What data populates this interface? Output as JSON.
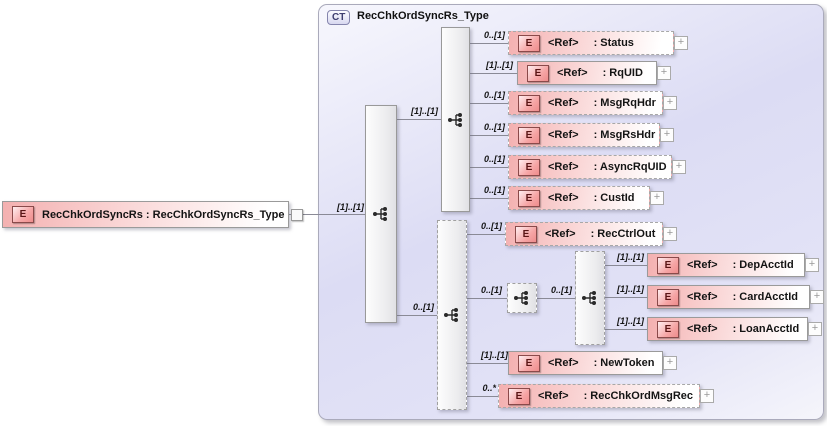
{
  "complex_type": {
    "badge": "CT",
    "title": "RecChkOrdSyncRs_Type"
  },
  "root_element": {
    "icon": "E",
    "label": "RecChkOrdSyncRs : RecChkOrdSyncRs_Type",
    "cardinality": "[1]..[1]"
  },
  "icons": {
    "element_letter": "E",
    "expand": "+",
    "sequence": "sequence-compositor"
  },
  "compositors": {
    "main": {
      "cardinality_in": "[1]..[1]",
      "cardinality_to_top": "[1]..[1]",
      "cardinality_to_bottom": "0..[1]"
    },
    "inner": {
      "cardinality_in": "0..[1]",
      "cardinality_out": "0..[1]"
    }
  },
  "nodes": {
    "status": {
      "icon": "E",
      "ref": "<Ref>",
      "name": ": Status",
      "cardinality": "0..[1]"
    },
    "rquid": {
      "icon": "E",
      "ref": "<Ref>",
      "name": ": RqUID",
      "cardinality": "[1]..[1]"
    },
    "msgrqhdr": {
      "icon": "E",
      "ref": "<Ref>",
      "name": ": MsgRqHdr",
      "cardinality": "0..[1]"
    },
    "msgrshdr": {
      "icon": "E",
      "ref": "<Ref>",
      "name": ": MsgRsHdr",
      "cardinality": "0..[1]"
    },
    "asyncrquid": {
      "icon": "E",
      "ref": "<Ref>",
      "name": ": AsyncRqUID",
      "cardinality": "0..[1]"
    },
    "custid": {
      "icon": "E",
      "ref": "<Ref>",
      "name": ": CustId",
      "cardinality": "0..[1]"
    },
    "recctrlout": {
      "icon": "E",
      "ref": "<Ref>",
      "name": ": RecCtrlOut",
      "cardinality": "0..[1]"
    },
    "depacctid": {
      "icon": "E",
      "ref": "<Ref>",
      "name": ": DepAcctId",
      "cardinality": "[1]..[1]"
    },
    "cardacctid": {
      "icon": "E",
      "ref": "<Ref>",
      "name": ": CardAcctId",
      "cardinality": "[1]..[1]"
    },
    "loanacctid": {
      "icon": "E",
      "ref": "<Ref>",
      "name": ": LoanAcctId",
      "cardinality": "[1]..[1]"
    },
    "newtoken": {
      "icon": "E",
      "ref": "<Ref>",
      "name": ": NewToken",
      "cardinality": "[1]..[1]"
    },
    "recchkordmsgrec": {
      "icon": "E",
      "ref": "<Ref>",
      "name": ": RecChkOrdMsgRec",
      "cardinality": "0..*"
    }
  }
}
